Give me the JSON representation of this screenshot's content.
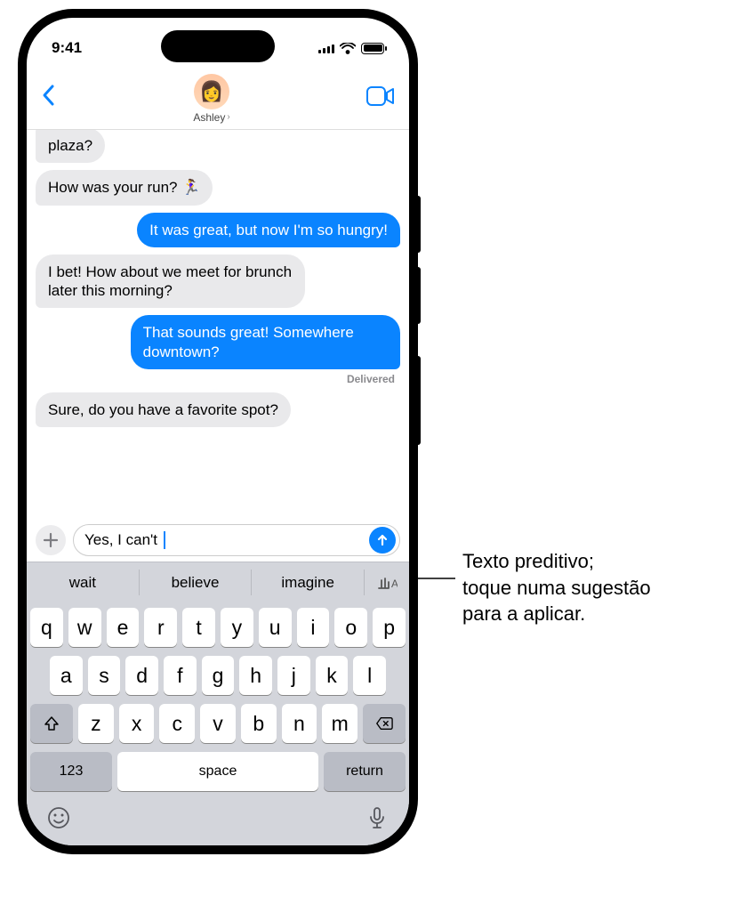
{
  "status": {
    "time": "9:41"
  },
  "nav": {
    "contact_name": "Ashley"
  },
  "messages": {
    "m0": "plaza?",
    "m1": "How was your run? 🏃‍♀️",
    "m2": "It was great, but now I'm so hungry!",
    "m3": "I bet! How about we meet for brunch later this morning?",
    "m4": "That sounds great! Somewhere downtown?",
    "delivered": "Delivered",
    "m5": "Sure, do you have a favorite spot?"
  },
  "input": {
    "text": "Yes, I can't "
  },
  "predictive": {
    "s1": "wait",
    "s2": "believe",
    "s3": "imagine"
  },
  "keyboard": {
    "row1": [
      "q",
      "w",
      "e",
      "r",
      "t",
      "y",
      "u",
      "i",
      "o",
      "p"
    ],
    "row2": [
      "a",
      "s",
      "d",
      "f",
      "g",
      "h",
      "j",
      "k",
      "l"
    ],
    "row3": [
      "z",
      "x",
      "c",
      "v",
      "b",
      "n",
      "m"
    ],
    "numbers": "123",
    "space": "space",
    "return": "return"
  },
  "callout": {
    "line1": "Texto preditivo;",
    "line2": "toque numa sugestão",
    "line3": "para a aplicar."
  }
}
